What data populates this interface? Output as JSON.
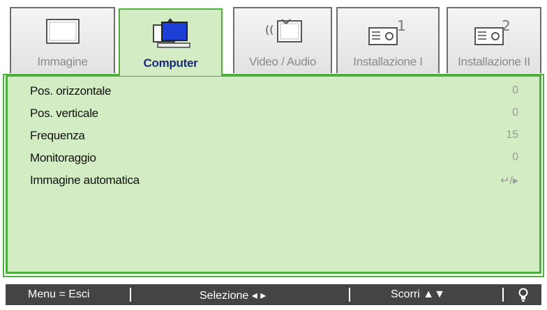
{
  "tabs": [
    {
      "label": "Immagine",
      "icon": "screen-icon",
      "active": false
    },
    {
      "label": "Computer",
      "icon": "computer-icon",
      "active": true
    },
    {
      "label": "Video / Audio",
      "icon": "video-audio-icon",
      "active": false
    },
    {
      "label": "Installazione I",
      "icon": "setup-1-icon",
      "active": false
    },
    {
      "label": "Installazione II",
      "icon": "setup-2-icon",
      "active": false
    }
  ],
  "menu": {
    "items": [
      {
        "label": "Pos. orizzontale",
        "value": "0"
      },
      {
        "label": "Pos. verticale",
        "value": "0"
      },
      {
        "label": "Frequenza",
        "value": "15"
      },
      {
        "label": "Monitoraggio",
        "value": "0"
      },
      {
        "label": "Immagine automatica",
        "value": "↵/▸"
      }
    ]
  },
  "footer": {
    "menu_exit": "Menu = Esci",
    "select": "Selezione ◂ ▸",
    "scroll": "Scorri ▲▼",
    "help_icon": "lightbulb-icon"
  },
  "colors": {
    "accent_green": "#4caf3c",
    "panel_bg": "#d4ecc4",
    "active_label": "#1a2a7a",
    "footer_bg": "#444444"
  }
}
